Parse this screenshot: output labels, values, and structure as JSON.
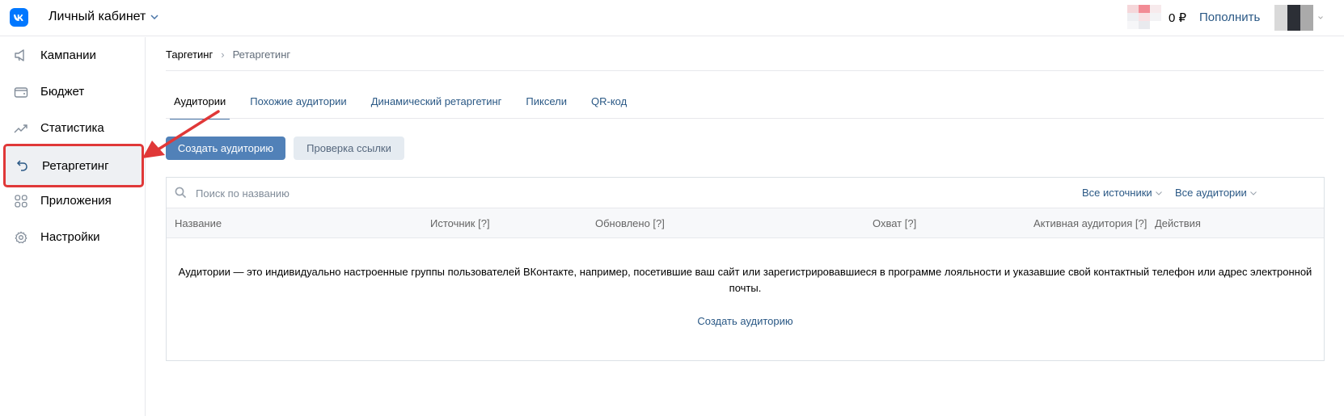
{
  "header": {
    "title": "Личный кабинет",
    "balance": "0 ₽",
    "topup_label": "Пополнить"
  },
  "sidebar": {
    "items": [
      {
        "label": "Кампании",
        "icon": "megaphone-icon"
      },
      {
        "label": "Бюджет",
        "icon": "wallet-icon"
      },
      {
        "label": "Статистика",
        "icon": "chart-line-icon"
      },
      {
        "label": "Ретаргетинг",
        "icon": "undo-arrow-icon",
        "active": true
      },
      {
        "label": "Приложения",
        "icon": "apps-grid-icon"
      },
      {
        "label": "Настройки",
        "icon": "gear-icon"
      }
    ]
  },
  "breadcrumb": {
    "parent": "Таргетинг",
    "separator": "›",
    "current": "Ретаргетинг"
  },
  "tabs": [
    {
      "label": "Аудитории",
      "active": true
    },
    {
      "label": "Похожие аудитории"
    },
    {
      "label": "Динамический ретаргетинг"
    },
    {
      "label": "Пиксели"
    },
    {
      "label": "QR-код"
    }
  ],
  "buttons": {
    "create_audience": "Создать аудиторию",
    "check_link": "Проверка ссылки"
  },
  "search": {
    "placeholder": "Поиск по названию",
    "value": ""
  },
  "filters": {
    "sources": "Все источники",
    "audiences": "Все аудитории"
  },
  "table": {
    "columns": [
      "Название",
      "Источник [?]",
      "Обновлено [?]",
      "Охват [?]",
      "Активная аудитория [?]",
      "Действия"
    ]
  },
  "empty_state": {
    "text": "Аудитории — это индивидуально настроенные группы пользователей ВКонтакте, например, посетившие ваш сайт или зарегистрировавшиеся в программе лояльности и указавшие свой контактный телефон или адрес электронной почты.",
    "link": "Создать аудиторию"
  },
  "colors": {
    "brand": "#0077ff",
    "primary_button": "#5181b8",
    "link": "#2a5885",
    "highlight": "#e03838"
  }
}
